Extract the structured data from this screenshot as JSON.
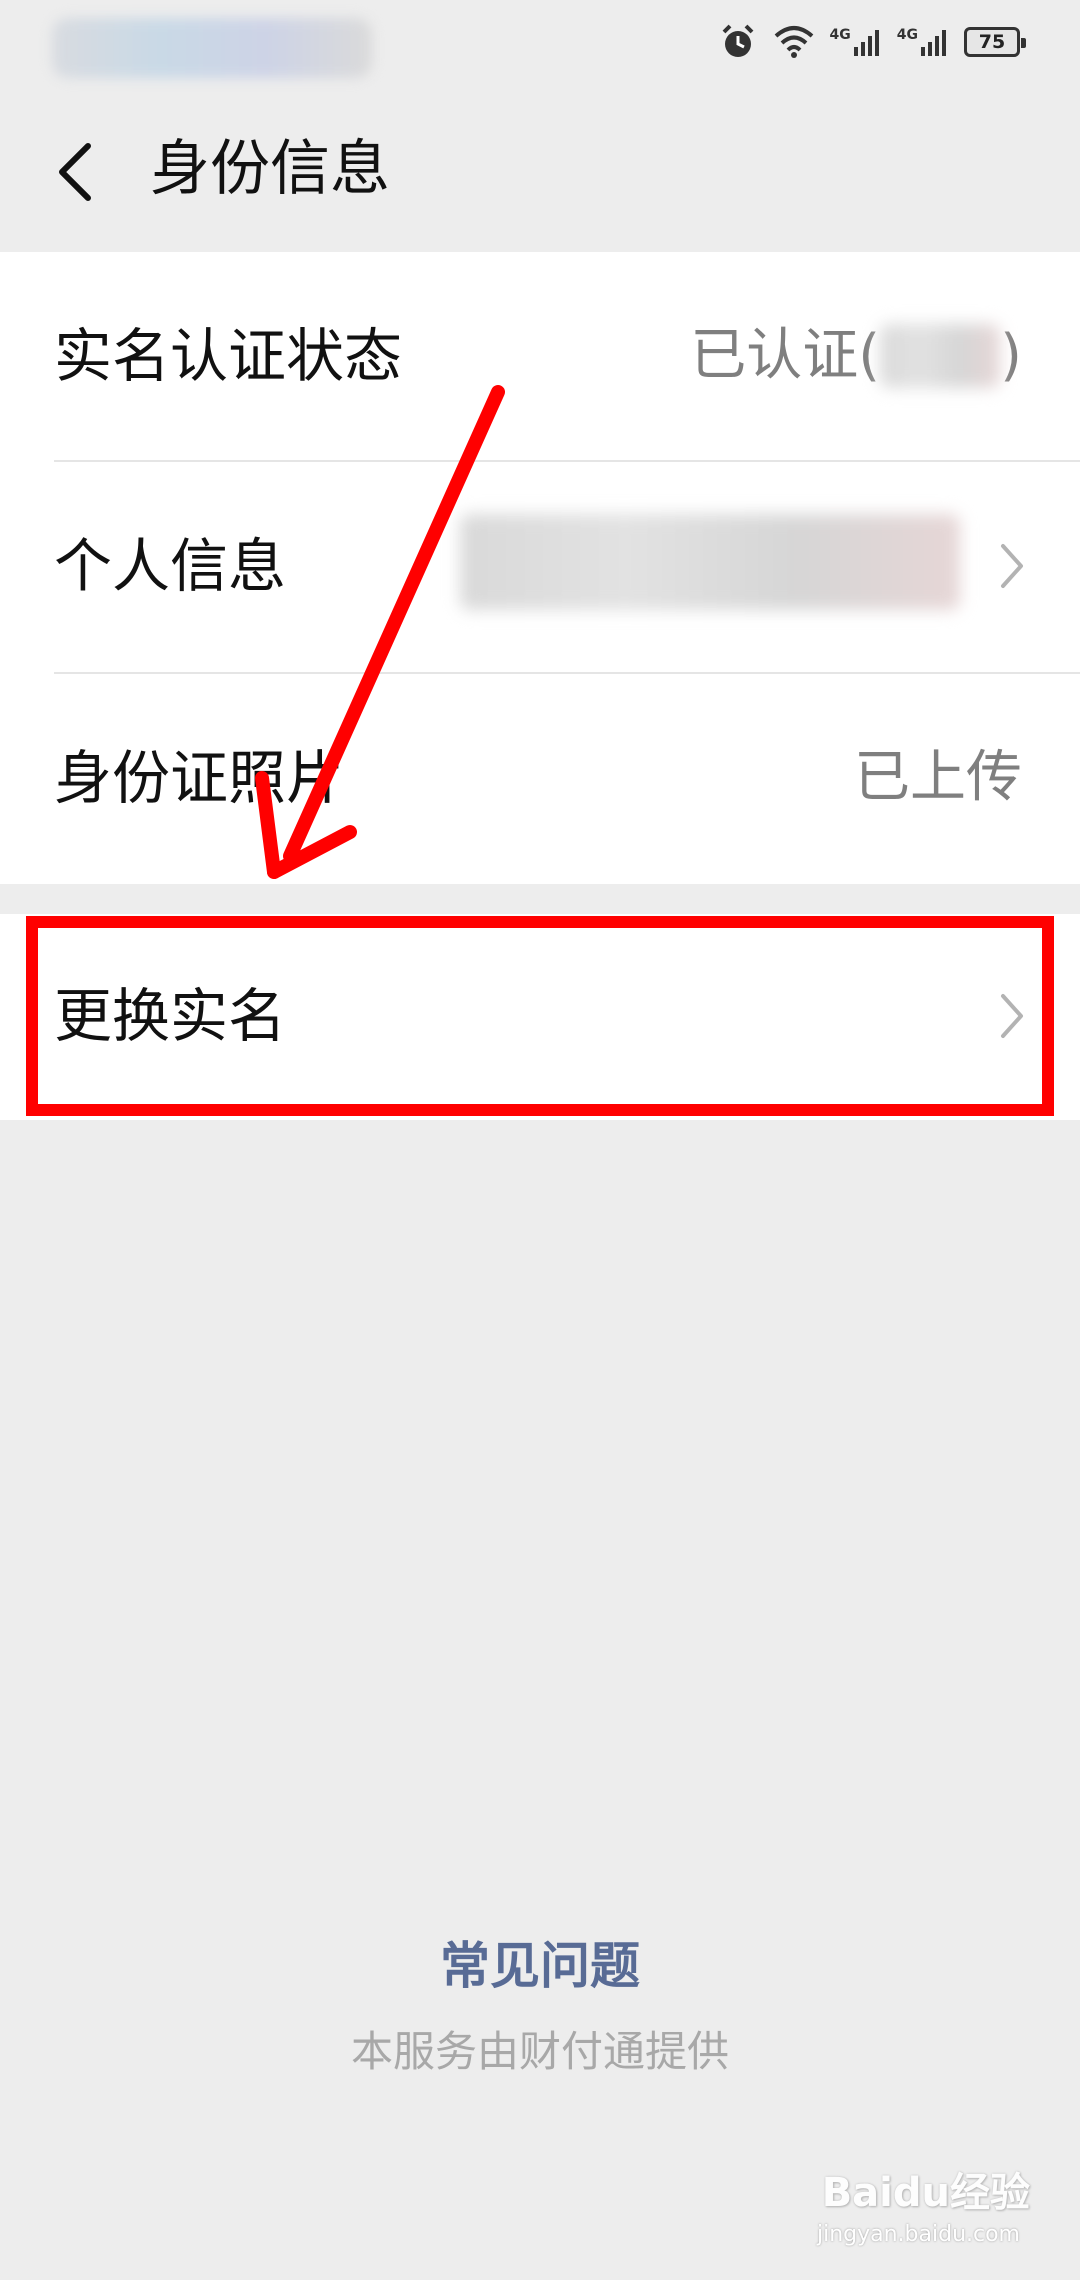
{
  "status_bar": {
    "network_1": "4G",
    "network_2": "4G",
    "battery": "75"
  },
  "header": {
    "title": "身份信息"
  },
  "rows": [
    {
      "label": "实名认证状态",
      "value": "已认证(",
      "value_close": ")"
    },
    {
      "label": "个人信息",
      "value": ""
    },
    {
      "label": "身份证照片",
      "value": "已上传"
    }
  ],
  "change_name": {
    "label": "更换实名"
  },
  "footer": {
    "faq": "常见问题",
    "provider": "本服务由财付通提供"
  },
  "watermark": {
    "text": "Baidu经验",
    "sub": "jingyan.baidu.com"
  },
  "colors": {
    "annotation_red": "#ff0000",
    "faq_link": "#586b95",
    "muted_text": "#7f7f7f",
    "background": "#ededed"
  }
}
